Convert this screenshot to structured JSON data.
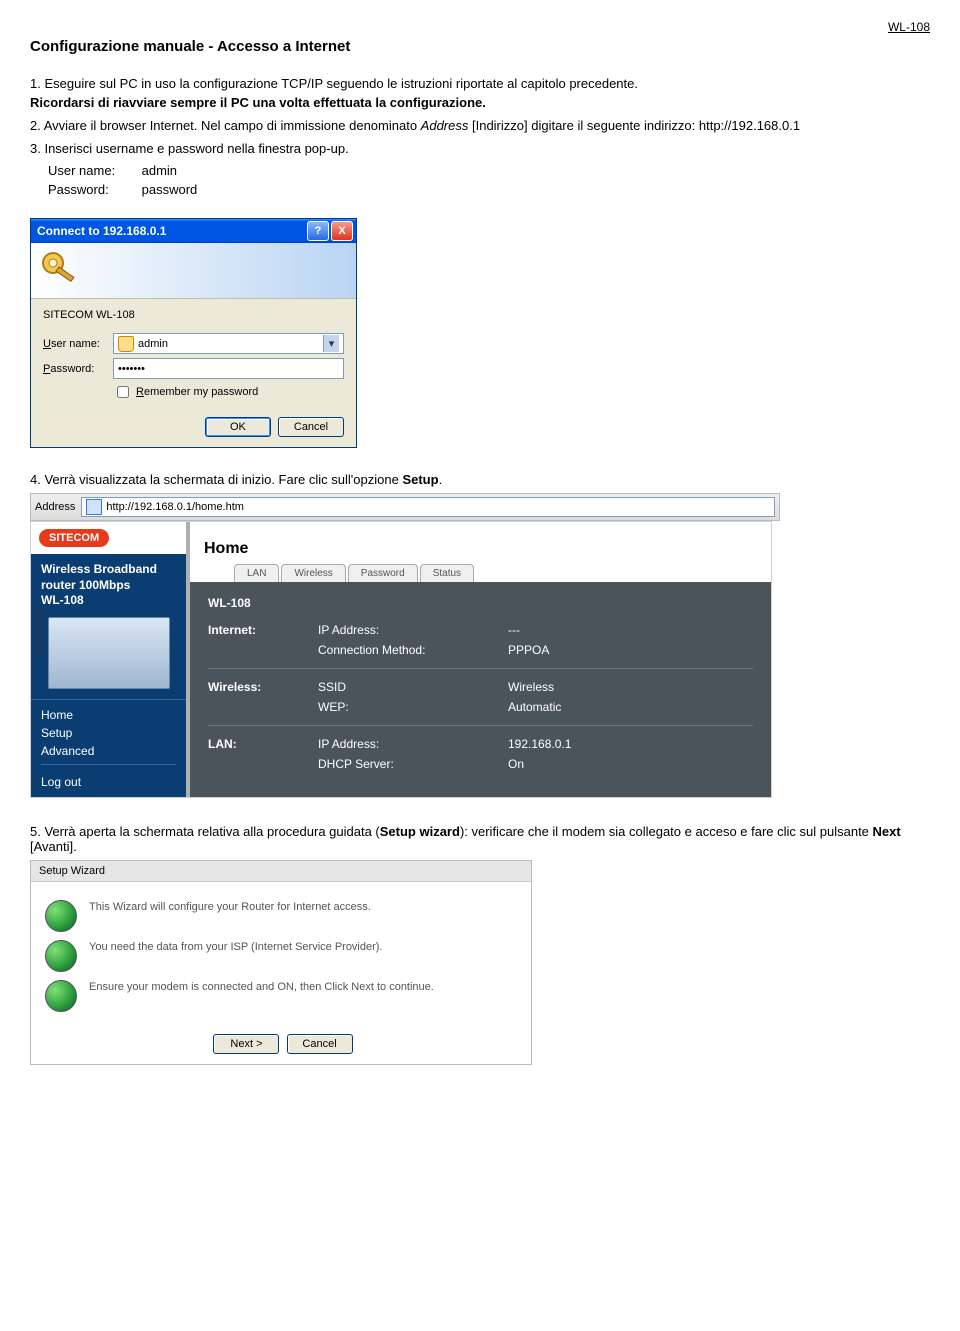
{
  "header": {
    "code": "WL-108"
  },
  "title": "Configurazione manuale - Accesso a Internet",
  "steps": {
    "s1a": "1. Eseguire sul PC in uso la configurazione TCP/IP seguendo le istruzioni riportate al capitolo precedente.",
    "s1b": "Ricordarsi di riavviare sempre il PC una volta effettuata la configurazione.",
    "s2a": "2. Avviare il browser Internet. Nel campo di immissione denominato ",
    "s2addr": "Address",
    "s2b": " [Indirizzo] digitare il seguente indirizzo: http://192.168.0.1",
    "s3": "3. Inserisci username e password nella finestra pop-up.",
    "cred_user_label": "User name:",
    "cred_user_val": "admin",
    "cred_pass_label": "Password:",
    "cred_pass_val": "password",
    "s4a": "4. Verrà visualizzata la schermata di inizio. Fare clic sull'opzione ",
    "s4b": "Setup",
    "s4c": ".",
    "s5a": "5. Verrà aperta la schermata relativa alla procedura guidata (",
    "s5b": "Setup wizard",
    "s5c": "): verificare che il modem sia collegato e acceso e fare clic sul pulsante ",
    "s5d": "Next",
    "s5e": " [Avanti]."
  },
  "dialog": {
    "title": "Connect to 192.168.0.1",
    "realm": "SITECOM WL-108",
    "user_label": "User name:",
    "user_value": "admin",
    "pass_label": "Password:",
    "pass_value": "•••••••",
    "remember": "Remember my password",
    "ok": "OK",
    "cancel": "Cancel",
    "help": "?",
    "close": "X"
  },
  "browser": {
    "label": "Address",
    "url": "http://192.168.0.1/home.htm"
  },
  "router": {
    "brand": "SITECOM",
    "prod1": "Wireless Broadband",
    "prod2": "router 100Mbps",
    "prod3": "WL-108",
    "nav_home": "Home",
    "nav_setup": "Setup",
    "nav_adv": "Advanced",
    "nav_logout": "Log out",
    "page_title": "Home",
    "tabs": [
      "LAN",
      "Wireless",
      "Password",
      "Status"
    ],
    "model": "WL-108",
    "rows": [
      {
        "c1": "Internet:",
        "c2": "IP Address:",
        "c3": "---"
      },
      {
        "c1": "",
        "c2": "Connection Method:",
        "c3": "PPPOA"
      },
      {
        "c1": "Wireless:",
        "c2": "SSID",
        "c3": "Wireless"
      },
      {
        "c1": "",
        "c2": "WEP:",
        "c3": "Automatic"
      },
      {
        "c1": "LAN:",
        "c2": "IP Address:",
        "c3": "192.168.0.1"
      },
      {
        "c1": "",
        "c2": "DHCP Server:",
        "c3": "On"
      }
    ]
  },
  "wizard": {
    "title": "Setup Wizard",
    "line1": "This Wizard will configure your Router for Internet access.",
    "line2": "You need the data from your ISP (Internet Service Provider).",
    "line3": "Ensure your modem is connected and ON, then Click Next to continue.",
    "next": "Next >",
    "cancel": "Cancel"
  }
}
